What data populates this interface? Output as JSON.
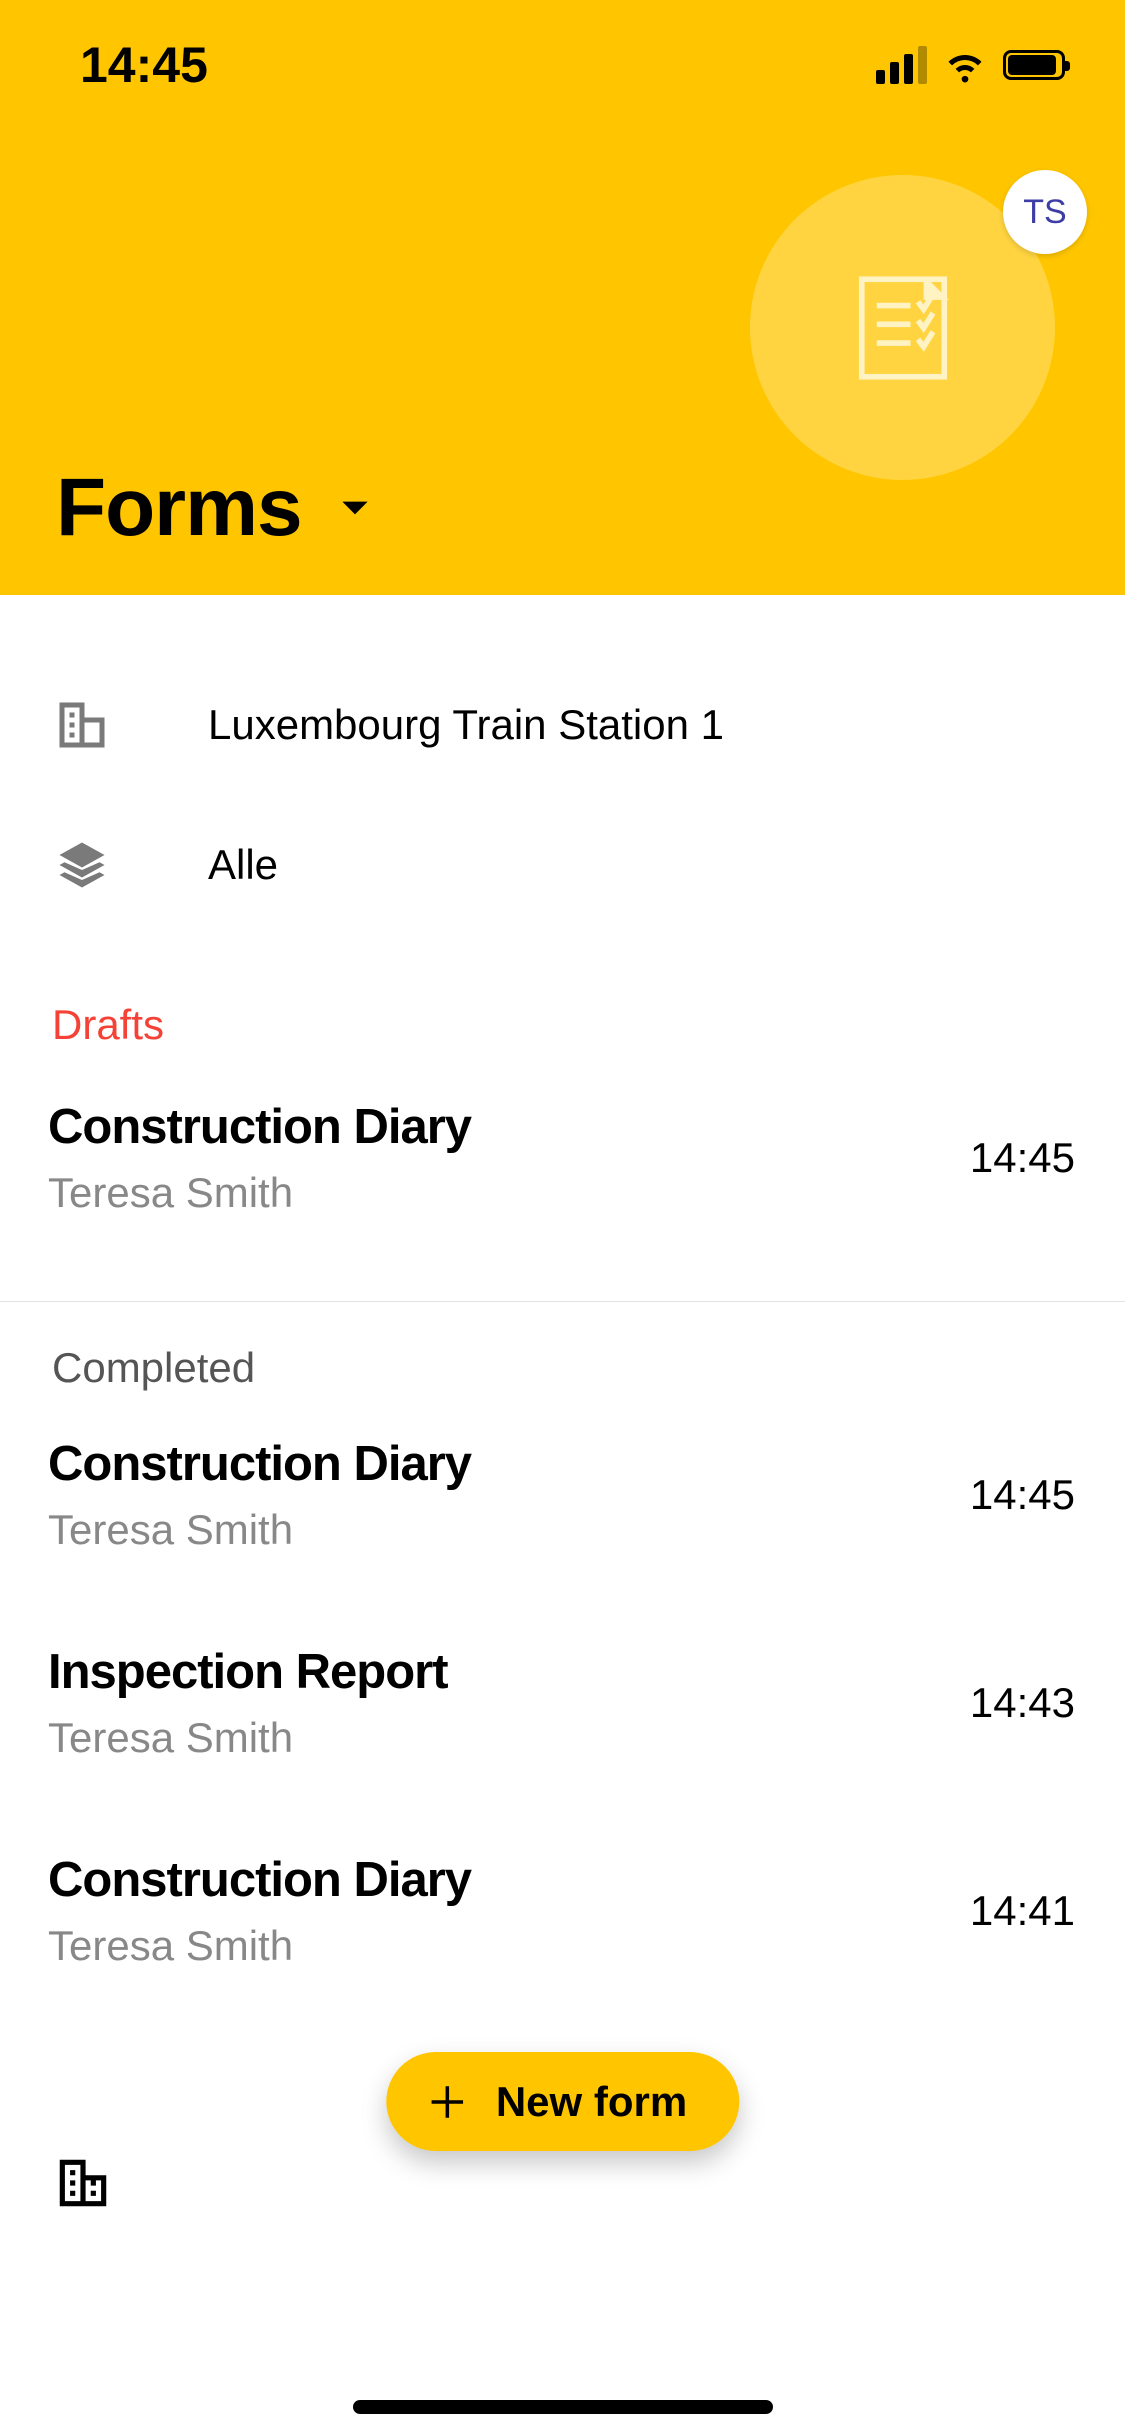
{
  "status": {
    "time": "14:45"
  },
  "header": {
    "title": "Forms",
    "avatar_initials": "TS"
  },
  "filters": {
    "project_label": "Luxembourg Train Station 1",
    "scope_label": "Alle"
  },
  "sections": {
    "drafts_label": "Drafts",
    "completed_label": "Completed"
  },
  "drafts": [
    {
      "title": "Construction Diary",
      "author": "Teresa Smith",
      "time": "14:45"
    }
  ],
  "completed": [
    {
      "title": "Construction Diary",
      "author": "Teresa Smith",
      "time": "14:45"
    },
    {
      "title": "Inspection Report",
      "author": "Teresa Smith",
      "time": "14:43"
    },
    {
      "title": "Construction Diary",
      "author": "Teresa Smith",
      "time": "14:41"
    }
  ],
  "fab": {
    "label": "New form"
  }
}
